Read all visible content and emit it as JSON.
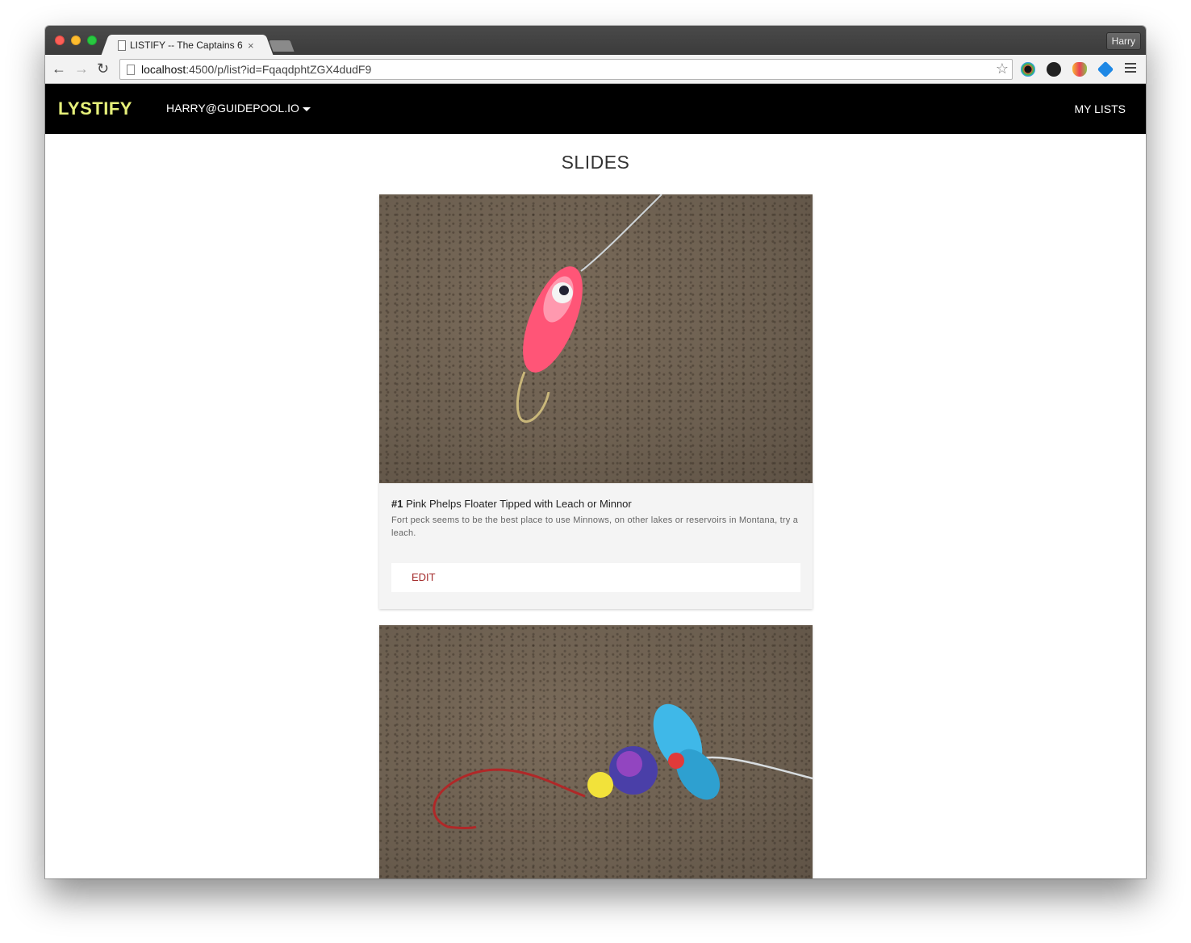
{
  "browser": {
    "tab_title": "LISTIFY -- The Captains 6",
    "tab_close": "×",
    "profile_name": "Harry",
    "url_host": "localhost",
    "url_rest": ":4500/p/list?id=FqaqdphtZGX4dudF9",
    "icons": [
      "back-icon",
      "forward-icon",
      "reload-icon",
      "star-icon",
      "menu-icon"
    ]
  },
  "navbar": {
    "brand": "LYSTIFY",
    "user_email": "HARRY@GUIDEPOOL.IO",
    "my_lists": "MY LISTS"
  },
  "page": {
    "title": "SLIDES"
  },
  "slides": [
    {
      "number": "#1",
      "title": "Pink Phelps Floater Tipped with Leach or Minnor",
      "description": "Fort peck seems to be the best place to use Minnows, on other lakes or reservoirs in Montana, try a leach.",
      "edit_label": "EDIT"
    }
  ],
  "colors": {
    "brand": "#e6f07a",
    "navbar_bg": "#000000",
    "edit_link": "#a32a2a"
  }
}
